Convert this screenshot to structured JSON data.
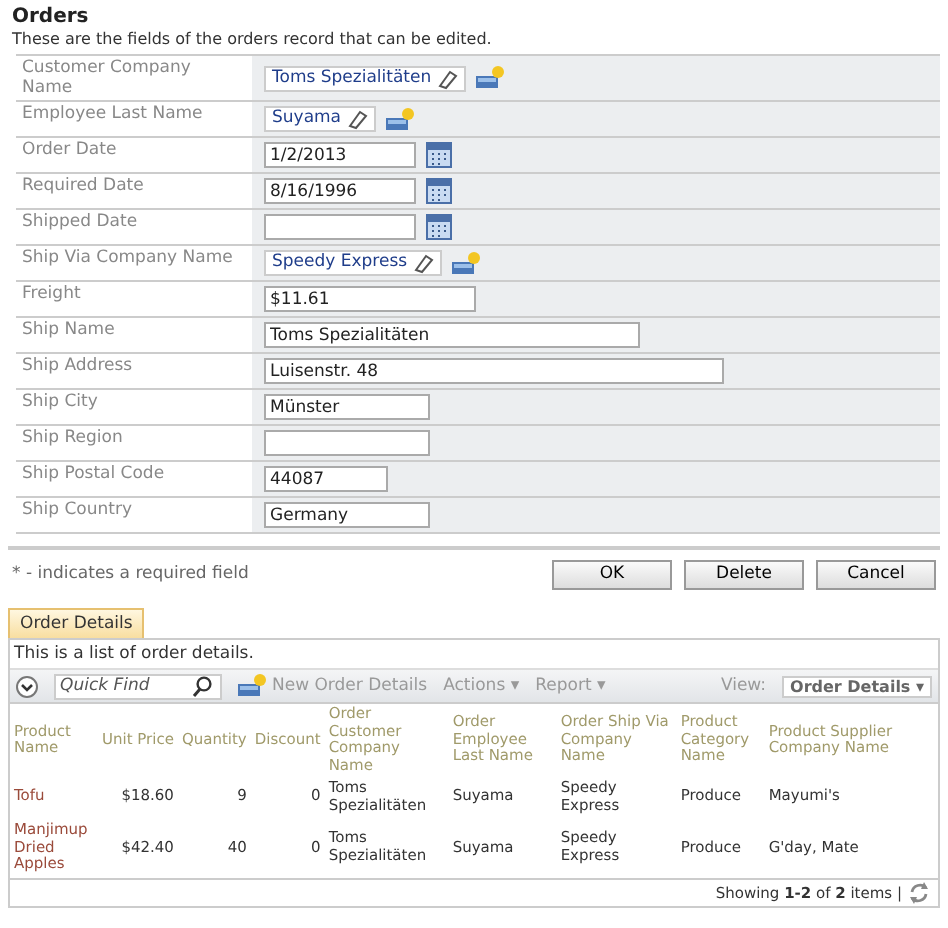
{
  "form": {
    "title": "Orders",
    "description": "These are the fields of the orders record that can be edited.",
    "fields": [
      {
        "label": "Customer Company Name",
        "kind": "lookup",
        "value": "Toms Spezialitäten"
      },
      {
        "label": "Employee Last Name",
        "kind": "lookup",
        "value": "Suyama"
      },
      {
        "label": "Order Date",
        "kind": "date",
        "value": "1/2/2013"
      },
      {
        "label": "Required Date",
        "kind": "date",
        "value": "8/16/1996"
      },
      {
        "label": "Shipped Date",
        "kind": "date"
      },
      {
        "label": "Ship Via Company Name",
        "kind": "lookup",
        "value": "Speedy Express"
      },
      {
        "label": "Freight",
        "kind": "text",
        "value": "$11.61"
      },
      {
        "label": "Ship Name",
        "kind": "text",
        "value": "Toms Spezialitäten"
      },
      {
        "label": "Ship Address",
        "kind": "text",
        "value": "Luisenstr. 48"
      },
      {
        "label": "Ship City",
        "kind": "text",
        "value": "Münster"
      },
      {
        "label": "Ship Region",
        "kind": "text"
      },
      {
        "label": "Ship Postal Code",
        "kind": "text",
        "value": "44087"
      },
      {
        "label": "Ship Country",
        "kind": "text",
        "value": "Germany"
      }
    ],
    "note": "* - indicates a required field",
    "buttons": [
      "OK",
      "Delete",
      "Cancel"
    ]
  },
  "tabs": [
    {
      "label": "Order Details",
      "selected": true
    }
  ],
  "grid": {
    "description": "This is a list of order details.",
    "quick_find": {
      "placeholder": "Quick Find"
    },
    "toolbar": [
      {
        "label": "New Order Details",
        "kind": "new"
      },
      {
        "label": "Actions ▾",
        "kind": "menu"
      },
      {
        "label": "Report ▾",
        "kind": "menu"
      }
    ],
    "view_label": "View:",
    "view": "Order Details ▾",
    "columns": [
      "Product Name",
      "Unit Price",
      "Quantity",
      "Discount",
      "Order Customer Company Name",
      "Order Employee Last Name",
      "Order Ship Via Company Name",
      "Product Category Name",
      "Product Supplier Company Name"
    ],
    "rows": [
      [
        "Tofu",
        "$18.60",
        "9",
        "0",
        "Toms Spezialitäten",
        "Suyama",
        "Speedy Express",
        "Produce",
        "Mayumi's"
      ],
      [
        "Manjimup Dried Apples",
        "$42.40",
        "40",
        "0",
        "Toms Spezialitäten",
        "Suyama",
        "Speedy Express",
        "Produce",
        "G'day, Mate"
      ]
    ],
    "pager": "Showing **1-2** of **2** items |"
  }
}
